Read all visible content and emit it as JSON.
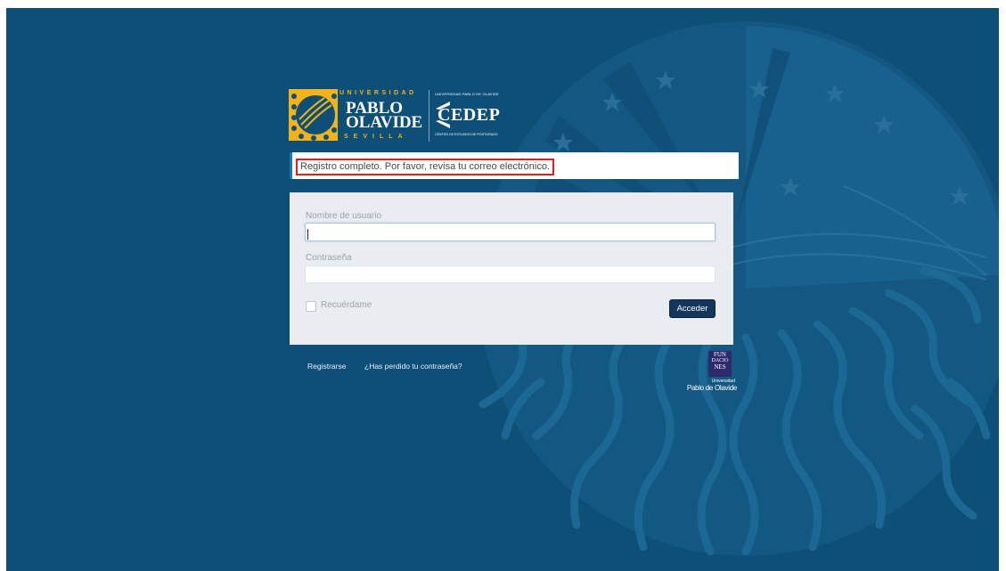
{
  "logos": {
    "upo": {
      "top_text": "UNIVERSIDAD",
      "line1": "PABLO",
      "line2": "OLAVIDE",
      "bottom_text": "SEVILLA"
    },
    "cedep": {
      "top_text": "UNIVERSIDAD PABLO DE OLAVIDE",
      "name": "CEDEP",
      "subtitle": "CENTRO DE ESTUDIOS DE POSTGRADO"
    },
    "fundaciones": {
      "box_lines": [
        "FUN",
        "DACIO",
        "NES"
      ],
      "line_small": "Universidad",
      "line_name": "Pablo de Olavide"
    }
  },
  "message": {
    "text": "Registro completo. Por favor, revisa tu correo electrónico."
  },
  "login": {
    "username_label": "Nombre de usuario",
    "username_value": "",
    "password_label": "Contraseña",
    "password_value": "",
    "remember_label": "Recuérdame",
    "remember_checked": false,
    "submit_label": "Acceder"
  },
  "footer": {
    "register_label": "Registrarse",
    "forgot_label": "¿Has perdido tu contraseña?"
  },
  "colors": {
    "background": "#0e4f78",
    "accent_yellow": "#f2b21a",
    "button": "#13365c",
    "highlight_border": "#e21c1c"
  }
}
